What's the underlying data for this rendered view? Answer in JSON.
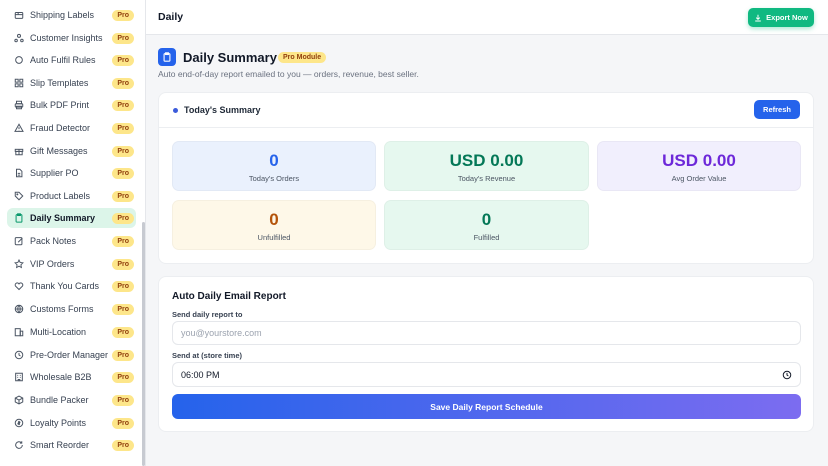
{
  "sidebar": {
    "items": [
      {
        "label": "Shipping Labels",
        "icon": "box-icon",
        "badge": "Pro"
      },
      {
        "label": "Customer Insights",
        "icon": "users-icon",
        "badge": "Pro"
      },
      {
        "label": "Auto Fulfil Rules",
        "icon": "circle-icon",
        "badge": "Pro"
      },
      {
        "label": "Slip Templates",
        "icon": "grid-icon",
        "badge": "Pro"
      },
      {
        "label": "Bulk PDF Print",
        "icon": "printer-icon",
        "badge": "Pro"
      },
      {
        "label": "Fraud Detector",
        "icon": "warning-icon",
        "badge": "Pro"
      },
      {
        "label": "Gift Messages",
        "icon": "gift-icon",
        "badge": "Pro"
      },
      {
        "label": "Supplier PO",
        "icon": "document-icon",
        "badge": "Pro"
      },
      {
        "label": "Product Labels",
        "icon": "tag-icon",
        "badge": "Pro"
      },
      {
        "label": "Daily Summary",
        "icon": "clipboard-icon",
        "badge": "Pro",
        "active": true
      },
      {
        "label": "Pack Notes",
        "icon": "note-icon",
        "badge": "Pro"
      },
      {
        "label": "VIP Orders",
        "icon": "star-icon",
        "badge": "Pro"
      },
      {
        "label": "Thank You Cards",
        "icon": "heart-icon",
        "badge": "Pro"
      },
      {
        "label": "Customs Forms",
        "icon": "globe-icon",
        "badge": "Pro"
      },
      {
        "label": "Multi-Location",
        "icon": "building-icon",
        "badge": "Pro"
      },
      {
        "label": "Pre-Order Manager",
        "icon": "clock-icon",
        "badge": "Pro"
      },
      {
        "label": "Wholesale B2B",
        "icon": "warehouse-icon",
        "badge": "Pro"
      },
      {
        "label": "Bundle Packer",
        "icon": "package-icon",
        "badge": "Pro"
      },
      {
        "label": "Loyalty Points",
        "icon": "coin-icon",
        "badge": "Pro"
      },
      {
        "label": "Smart Reorder",
        "icon": "refresh-icon",
        "badge": "Pro"
      }
    ]
  },
  "topbar": {
    "title": "Daily",
    "export_label": "Export Now"
  },
  "header": {
    "title": "Daily Summary",
    "badge": "Pro Module",
    "subtitle": "Auto end-of-day report emailed to you — orders, revenue, best seller."
  },
  "summary": {
    "title": "Today's Summary",
    "refresh_label": "Refresh",
    "stats": [
      {
        "value": "0",
        "label": "Today's Orders",
        "color": "#2563eb"
      },
      {
        "value": "USD 0.00",
        "label": "Today's Revenue",
        "color": "#047857"
      },
      {
        "value": "USD 0.00",
        "label": "Avg Order Value",
        "color": "#6d28d9"
      },
      {
        "value": "0",
        "label": "Unfulfilled",
        "color": "#b45309"
      },
      {
        "value": "0",
        "label": "Fulfilled",
        "color": "#047857"
      }
    ]
  },
  "email_report": {
    "title": "Auto Daily Email Report",
    "send_to_label": "Send daily report to",
    "send_to_placeholder": "you@yourstore.com",
    "send_at_label": "Send at (store time)",
    "send_at_value": "06:00 PM",
    "save_label": "Save Daily Report Schedule"
  },
  "colors": {
    "primary": "#2563eb",
    "success": "#10b981",
    "pro_badge_bg": "#fde68a",
    "active_nav_bg": "#dcf5e9"
  }
}
